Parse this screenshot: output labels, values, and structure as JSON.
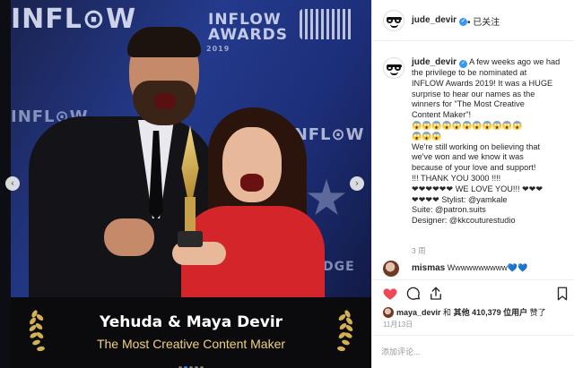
{
  "colors": {
    "accent": "#3897f0",
    "like_red": "#ed4956",
    "caption_gold": "#f2d27a",
    "text": "#262626",
    "muted": "#999999"
  },
  "media": {
    "wall_text": {
      "brand_big": "INFL⊙W",
      "awards_title": "INFLOW\nAWARDS",
      "awards_year": "2019",
      "left_logo": "INFL⊙W",
      "right_logo": "INFL⊙W",
      "bottom_logo": "RIDGE"
    },
    "caption_title": "Yehuda & Maya Devir",
    "caption_subtitle": "The Most Creative Content Maker",
    "carousel": {
      "count": 5,
      "active": 1
    },
    "prev_arrow": "‹",
    "next_arrow": "›"
  },
  "header": {
    "username": "jude_devir",
    "verified": "✓",
    "follow_status": "• 已关注"
  },
  "post": {
    "username": "jude_devir",
    "caption_lines": [
      " A few weeks ago we had",
      "the privilege to be nominated at",
      "INFLOW Awards 2019! It was a HUGE",
      "surprise to hear our names as the",
      "winners for \"The Most Creative",
      "Content Maker\"!"
    ],
    "emoji_row_1": "😱😱😱😱😱😱😱😱😱😱😱",
    "emoji_row_2": "😱😱😱",
    "caption_lines_2": [
      "We're still working on believing that",
      "we've won and we know it was",
      "because of your love and support!",
      "!!! THANK YOU 3000 !!!!",
      "❤❤❤❤❤❤ WE LOVE YOU!!! ❤❤❤",
      "❤❤❤❤ Stylist: @yamkale",
      "Suite: @patron.suits",
      "Designer: @kkcouturestudio"
    ],
    "time_ago": "3 周"
  },
  "comment": {
    "username": "mismas",
    "text": " Wwwwwwwwww",
    "hearts": "💙💙"
  },
  "actions": {
    "like_icon": "heart-filled-icon",
    "comment_icon": "comment-bubble-icon",
    "share_icon": "share-upload-icon",
    "save_icon": "bookmark-icon",
    "liked_by_user": "maya_devir",
    "liked_by_mid": " 和 ",
    "liked_by_others_label": "其他 410,379 位用户",
    "liked_by_suffix": " 赞了",
    "date": "11月13日"
  },
  "add_comment": {
    "placeholder": "添加评论..."
  }
}
